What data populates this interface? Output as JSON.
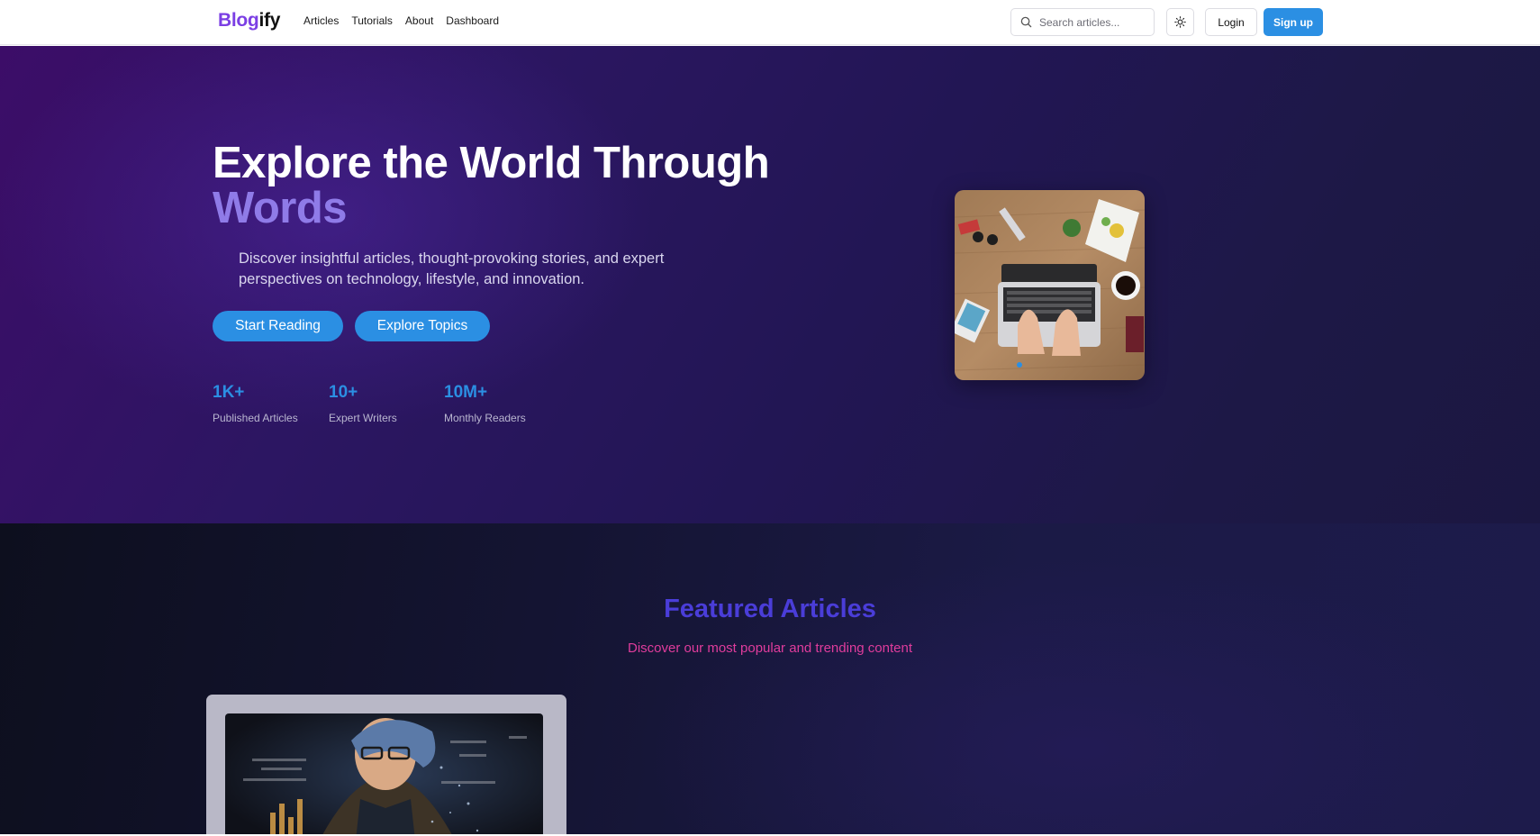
{
  "header": {
    "logo_part1": "Blog",
    "logo_part2": "ify",
    "nav": [
      "Articles",
      "Tutorials",
      "About",
      "Dashboard"
    ],
    "search_placeholder": "Search articles...",
    "login": "Login",
    "signup": "Sign up"
  },
  "hero": {
    "title_line1": "Explore the World Through",
    "title_line2": "Words",
    "description": "Discover insightful articles, thought-provoking stories, and expert perspectives on technology, lifestyle, and innovation.",
    "btn_start": "Start Reading",
    "btn_explore": "Explore Topics",
    "stats": [
      {
        "value": "1K+",
        "label": "Published Articles"
      },
      {
        "value": "10+",
        "label": "Expert Writers"
      },
      {
        "value": "10M+",
        "label": "Monthly Readers"
      }
    ]
  },
  "featured": {
    "title": "Featured Articles",
    "subtitle": "Discover our most popular and trending content"
  },
  "colors": {
    "brand_purple": "#7b3fe4",
    "primary_blue": "#2b8fe3",
    "accent_violet": "#8f7be8",
    "featured_title": "#4a3dd8",
    "featured_subtitle": "#e03c9c"
  }
}
